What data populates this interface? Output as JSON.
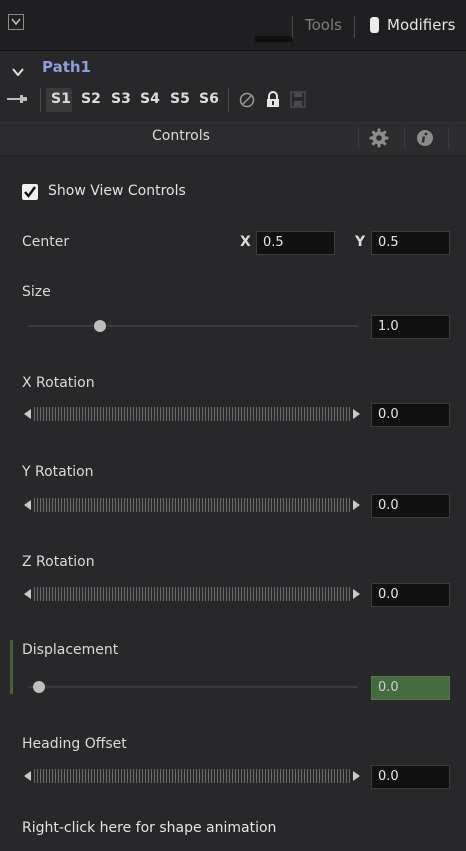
{
  "colors": {
    "accent_path": "#8d9ed8",
    "highlight_field": "#446b3e",
    "background": "#28282a"
  },
  "topbar": {
    "tools_tab": "Tools",
    "modifiers_tab": "Modifiers"
  },
  "path": {
    "title": "Path1"
  },
  "versions": [
    "S1",
    "S2",
    "S3",
    "S4",
    "S5",
    "S6"
  ],
  "icons": [
    "collapse-icon",
    "pin-icon",
    "no-entry-icon",
    "lock-icon",
    "save-icon",
    "gear-icon",
    "info-icon"
  ],
  "controls": {
    "header": "Controls"
  },
  "show_view_controls": {
    "label": "Show View Controls",
    "checked": true
  },
  "center": {
    "label": "Center",
    "x_label": "X",
    "x_value": "0.5",
    "y_label": "Y",
    "y_value": "0.5"
  },
  "size": {
    "label": "Size",
    "value": "1.0"
  },
  "x_rotation": {
    "label": "X Rotation",
    "value": "0.0"
  },
  "y_rotation": {
    "label": "Y Rotation",
    "value": "0.0"
  },
  "z_rotation": {
    "label": "Z Rotation",
    "value": "0.0"
  },
  "displacement": {
    "label": "Displacement",
    "value": "0.0"
  },
  "heading_offset": {
    "label": "Heading Offset",
    "value": "0.0"
  },
  "footer": {
    "text": "Right-click here for shape animation"
  }
}
